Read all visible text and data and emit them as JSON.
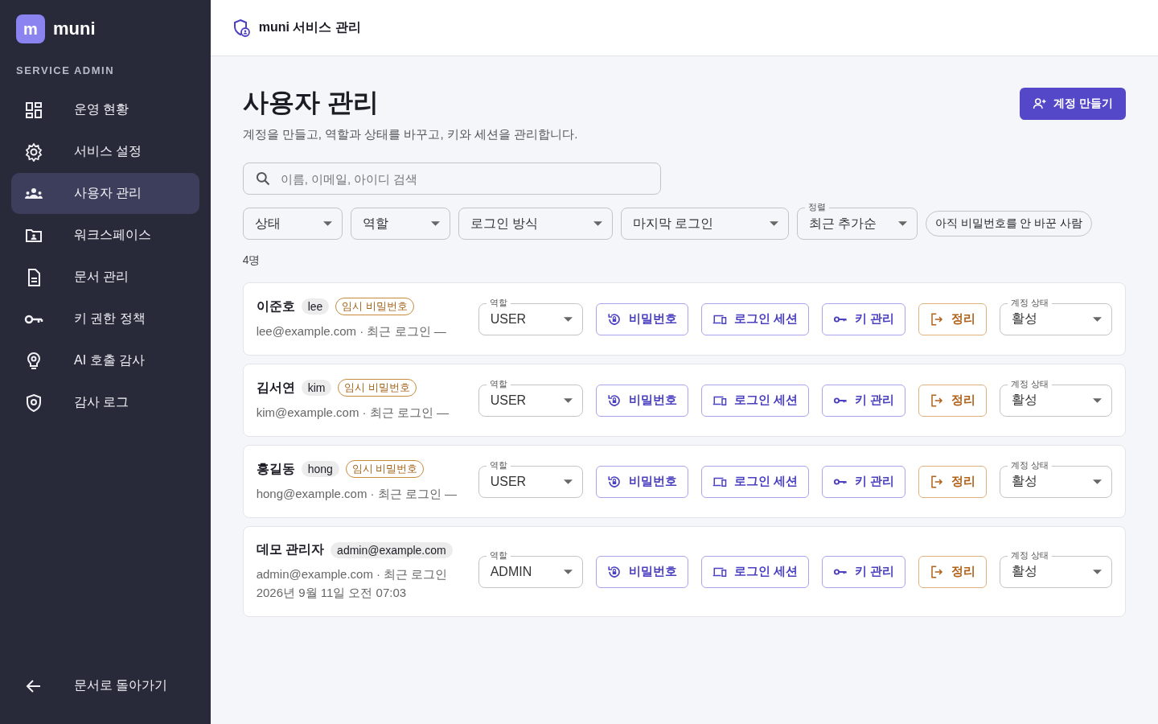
{
  "sidebar": {
    "logo_letter": "m",
    "brand": "muni",
    "section": "SERVICE ADMIN",
    "items": [
      {
        "label": "운영 현황",
        "selected": false
      },
      {
        "label": "서비스 설정",
        "selected": false
      },
      {
        "label": "사용자 관리",
        "selected": true
      },
      {
        "label": "워크스페이스",
        "selected": false
      },
      {
        "label": "문서 관리",
        "selected": false
      },
      {
        "label": "키 권한 정책",
        "selected": false
      },
      {
        "label": "AI 호출 감사",
        "selected": false
      },
      {
        "label": "감사 로그",
        "selected": false
      }
    ],
    "back": "문서로 돌아가기"
  },
  "header": {
    "title": "muni 서비스 관리"
  },
  "page": {
    "title": "사용자 관리",
    "subtitle": "계정을 만들고, 역할과 상태를 바꾸고, 키와 세션을 관리합니다.",
    "create_button": "계정 만들기",
    "search": {
      "placeholder": "이름, 이메일, 아이디 검색"
    },
    "filters": [
      {
        "kind": "select",
        "value": "상태"
      },
      {
        "kind": "select",
        "value": "역할"
      },
      {
        "kind": "select",
        "value": "로그인 방식"
      },
      {
        "kind": "select",
        "value": "마지막 로그인"
      },
      {
        "kind": "labeled",
        "label": "정렬",
        "value": "최근 추가순"
      },
      {
        "kind": "chip",
        "value": "아직 비밀번호를 안 바꾼 사람"
      }
    ],
    "count": "4명",
    "users": [
      {
        "name": "이준호",
        "handle": "lee",
        "badge": "임시 비밀번호",
        "meta": "lee@example.com · 최근 로그인 —",
        "role_label": "역할",
        "role": "USER",
        "actions": [
          {
            "kind": "password",
            "label": "비밀번호"
          },
          {
            "kind": "sessions",
            "label": "로그인 세션"
          },
          {
            "kind": "keys",
            "label": "키 관리"
          },
          {
            "kind": "cleanup",
            "label": "정리"
          }
        ],
        "status_label": "계정 상태",
        "status": "활성"
      },
      {
        "name": "김서연",
        "handle": "kim",
        "badge": "임시 비밀번호",
        "meta": "kim@example.com · 최근 로그인 —",
        "role_label": "역할",
        "role": "USER",
        "actions": [
          {
            "kind": "password",
            "label": "비밀번호"
          },
          {
            "kind": "sessions",
            "label": "로그인 세션"
          },
          {
            "kind": "keys",
            "label": "키 관리"
          },
          {
            "kind": "cleanup",
            "label": "정리"
          }
        ],
        "status_label": "계정 상태",
        "status": "활성"
      },
      {
        "name": "홍길동",
        "handle": "hong",
        "badge": "임시 비밀번호",
        "meta": "hong@example.com · 최근 로그인 —",
        "role_label": "역할",
        "role": "USER",
        "actions": [
          {
            "kind": "password",
            "label": "비밀번호"
          },
          {
            "kind": "sessions",
            "label": "로그인 세션"
          },
          {
            "kind": "keys",
            "label": "키 관리"
          },
          {
            "kind": "cleanup",
            "label": "정리"
          }
        ],
        "status_label": "계정 상태",
        "status": "활성"
      },
      {
        "name": "데모 관리자",
        "handle": "admin@example.com",
        "meta": "admin@example.com · 최근 로그인 2026년 9월 11일 오전 07:03",
        "role_label": "역할",
        "role": "ADMIN",
        "actions": [
          {
            "kind": "password",
            "label": "비밀번호"
          },
          {
            "kind": "sessions",
            "label": "로그인 세션"
          },
          {
            "kind": "keys",
            "label": "키 관리"
          },
          {
            "kind": "cleanup",
            "label": "정리"
          }
        ],
        "status_label": "계정 상태",
        "status": "활성"
      }
    ]
  }
}
